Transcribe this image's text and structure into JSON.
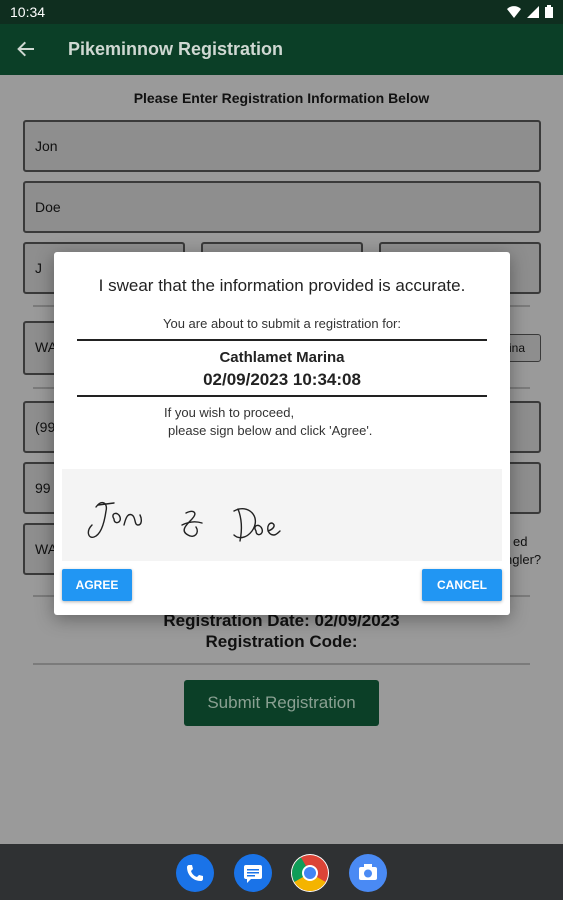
{
  "status": {
    "time": "10:34"
  },
  "appbar": {
    "title": "Pikeminnow Registration"
  },
  "form": {
    "heading": "Please Enter Registration Information Below",
    "first_name": "Jon",
    "last_name": "Doe",
    "middle_initial": "J",
    "state_partial": "WA",
    "location_partial": "rina",
    "phone_partial": "(99",
    "number_partial": "99",
    "state2_partial": "WA",
    "side_label_1": "ed",
    "side_label_2": "ngler?",
    "registration_date": "Registration Date:  02/09/2023",
    "registration_code": "Registration Code:",
    "submit_label": "Submit Registration"
  },
  "dialog": {
    "title": "I swear that the information provided is accurate.",
    "subtitle": "You are about to submit a registration for:",
    "location": "Cathlamet Marina",
    "datetime": "02/09/2023 10:34:08",
    "instruction_line1": "If you wish to proceed,",
    "instruction_line2": "please sign below and click 'Agree'.",
    "agree_label": "AGREE",
    "cancel_label": "CANCEL",
    "signature_text": "Jon J Doe"
  },
  "nav_icons": [
    "phone-icon",
    "messages-icon",
    "chrome-icon",
    "camera-icon"
  ]
}
